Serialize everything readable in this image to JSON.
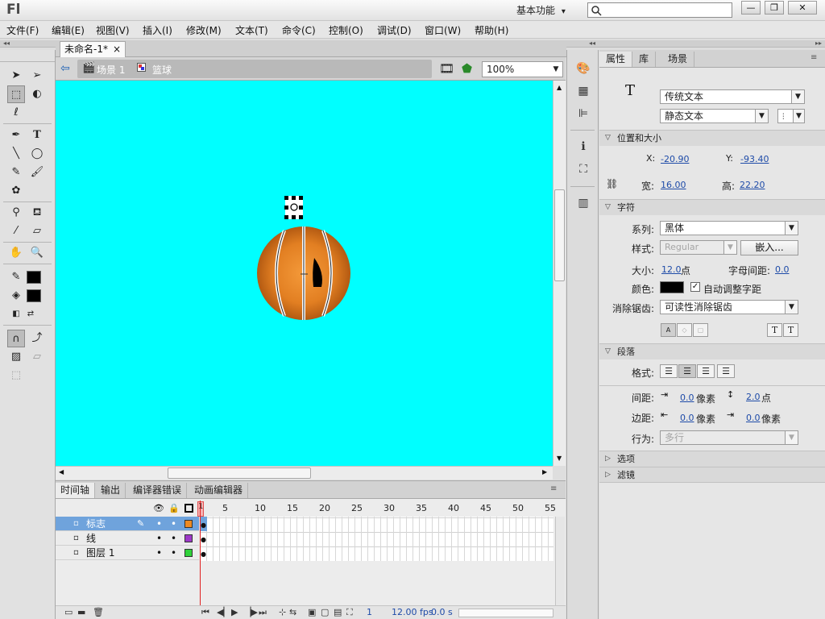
{
  "app": {
    "logo": "Fl",
    "workspace": "基本功能",
    "workspace_arrow": "▾"
  },
  "window_buttons": {
    "minimize": "—",
    "maximize": "❐",
    "close": "✕"
  },
  "menu": [
    "文件(F)",
    "编辑(E)",
    "视图(V)",
    "插入(I)",
    "修改(M)",
    "文本(T)",
    "命令(C)",
    "控制(O)",
    "调试(D)",
    "窗口(W)",
    "帮助(H)"
  ],
  "document": {
    "tab_label": "未命名-1*",
    "tab_close": "×"
  },
  "edit_bar": {
    "scene": "场景 1",
    "symbol": "篮球",
    "zoom": "100%"
  },
  "stage": {
    "background": "#00ffff",
    "ball_color": "#e8862a",
    "ball_dark": "#b85c14",
    "seam_color": "#ffffff"
  },
  "timeline": {
    "tabs": [
      "时间轴",
      "输出",
      "编译器错误",
      "动画编辑器"
    ],
    "frame_numbers": [
      "1",
      "5",
      "10",
      "15",
      "20",
      "25",
      "30",
      "35",
      "40",
      "45",
      "50",
      "55"
    ],
    "layers": [
      {
        "name": "标志",
        "color": "#ee8a22",
        "selected": true
      },
      {
        "name": "线",
        "color": "#9e39c9",
        "selected": false
      },
      {
        "name": "图层 1",
        "color": "#2fd23a",
        "selected": false
      }
    ],
    "current_frame": "1",
    "fps": "12.00",
    "fps_unit": "fps",
    "time": "0.0 s"
  },
  "properties": {
    "tabs": [
      "属性",
      "库",
      "场景"
    ],
    "text_tool_glyph": "T",
    "text_engine": "传统文本",
    "text_type": "静态文本",
    "position_size": {
      "header": "位置和大小",
      "x_label": "X:",
      "x": "-20.90",
      "y_label": "Y:",
      "y": "-93.40",
      "w_label": "宽:",
      "w": "16.00",
      "h_label": "高:",
      "h": "22.20"
    },
    "character": {
      "header": "字符",
      "family_label": "系列:",
      "family": "黑体",
      "style_label": "样式:",
      "style": "Regular",
      "embed_button": "嵌入...",
      "size_label": "大小:",
      "size": "12.0",
      "size_unit": "点",
      "letter_spacing_label": "字母间距:",
      "letter_spacing": "0.0",
      "color_label": "颜色:",
      "color": "#000000",
      "auto_kern_label": "自动调整字距",
      "auto_kern": true,
      "antialias_label": "消除锯齿:",
      "antialias": "可读性消除锯齿"
    },
    "paragraph": {
      "header": "段落",
      "format_label": "格式:",
      "spacing_label": "间距:",
      "indent": "0.0",
      "indent_unit": "像素",
      "line_spacing": "2.0",
      "line_spacing_unit": "点",
      "margin_label": "边距:",
      "left_margin": "0.0",
      "left_margin_unit": "像素",
      "right_margin": "0.0",
      "right_margin_unit": "像素",
      "behavior_label": "行为:",
      "behavior": "多行"
    },
    "options_header": "选项",
    "filters_header": "滤镜"
  }
}
